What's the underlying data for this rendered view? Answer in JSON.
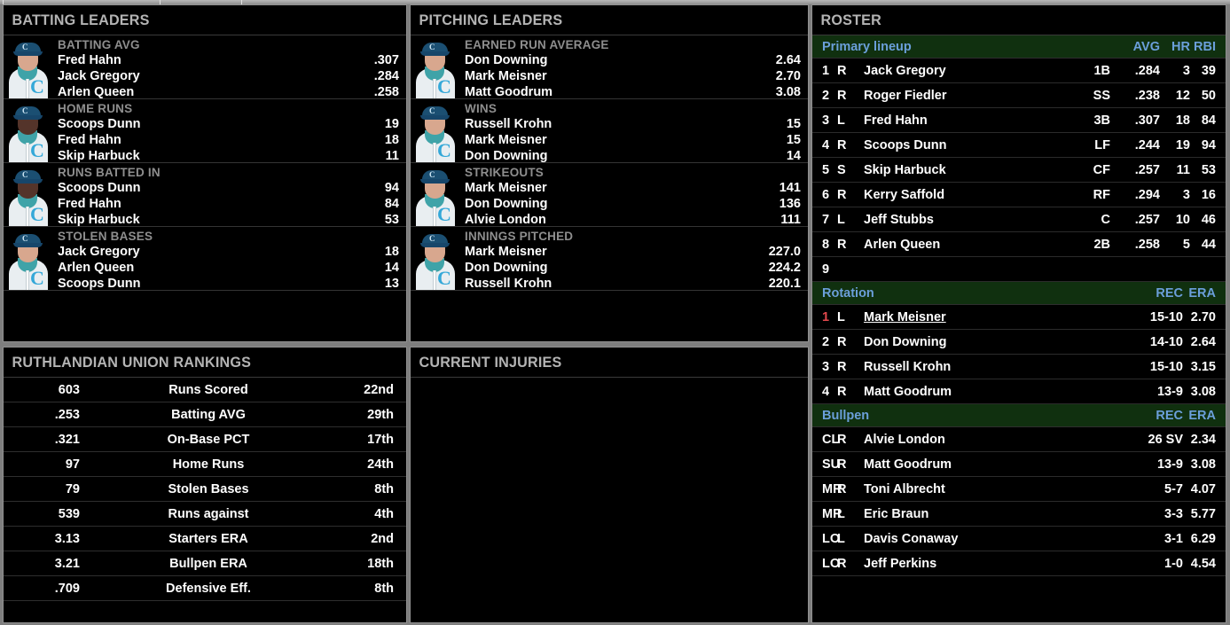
{
  "theme": {
    "panel_bg": "#000000",
    "panel_border": "#909090",
    "app_bg": "#7e7e7e",
    "title_color": "#b4b4b4",
    "section_header_bg": "#10300f",
    "section_header_text": "#6b9fda",
    "highlight_red": "#e2484c"
  },
  "batting_leaders": {
    "title": "BATTING LEADERS",
    "groups": [
      {
        "category": "BATTING AVG",
        "portrait": "player-portrait-light",
        "rows": [
          {
            "name": "Fred Hahn",
            "value": ".307"
          },
          {
            "name": "Jack Gregory",
            "value": ".284"
          },
          {
            "name": "Arlen Queen",
            "value": ".258"
          }
        ]
      },
      {
        "category": "HOME RUNS",
        "portrait": "player-portrait-dark",
        "rows": [
          {
            "name": "Scoops Dunn",
            "value": "19"
          },
          {
            "name": "Fred Hahn",
            "value": "18"
          },
          {
            "name": "Skip Harbuck",
            "value": "11"
          }
        ]
      },
      {
        "category": "RUNS BATTED IN",
        "portrait": "player-portrait-dark",
        "rows": [
          {
            "name": "Scoops Dunn",
            "value": "94"
          },
          {
            "name": "Fred Hahn",
            "value": "84"
          },
          {
            "name": "Skip Harbuck",
            "value": "53"
          }
        ]
      },
      {
        "category": "STOLEN BASES",
        "portrait": "player-portrait-light",
        "rows": [
          {
            "name": "Jack Gregory",
            "value": "18"
          },
          {
            "name": "Arlen Queen",
            "value": "14"
          },
          {
            "name": "Scoops Dunn",
            "value": "13"
          }
        ]
      }
    ]
  },
  "pitching_leaders": {
    "title": "PITCHING LEADERS",
    "groups": [
      {
        "category": "EARNED RUN AVERAGE",
        "portrait": "player-portrait-light",
        "rows": [
          {
            "name": "Don Downing",
            "value": "2.64"
          },
          {
            "name": "Mark Meisner",
            "value": "2.70"
          },
          {
            "name": "Matt Goodrum",
            "value": "3.08"
          }
        ]
      },
      {
        "category": "WINS",
        "portrait": "player-portrait-light",
        "rows": [
          {
            "name": "Russell Krohn",
            "value": "15"
          },
          {
            "name": "Mark Meisner",
            "value": "15"
          },
          {
            "name": "Don Downing",
            "value": "14"
          }
        ]
      },
      {
        "category": "STRIKEOUTS",
        "portrait": "player-portrait-light",
        "rows": [
          {
            "name": "Mark Meisner",
            "value": "141"
          },
          {
            "name": "Don Downing",
            "value": "136"
          },
          {
            "name": "Alvie London",
            "value": "111"
          }
        ]
      },
      {
        "category": "INNINGS PITCHED",
        "portrait": "player-portrait-light",
        "rows": [
          {
            "name": "Mark Meisner",
            "value": "227.0"
          },
          {
            "name": "Don Downing",
            "value": "224.2"
          },
          {
            "name": "Russell Krohn",
            "value": "220.1"
          }
        ]
      }
    ]
  },
  "rankings": {
    "title": "RUTHLANDIAN UNION RANKINGS",
    "rows": [
      {
        "value": "603",
        "label": "Runs Scored",
        "rank": "22nd"
      },
      {
        "value": ".253",
        "label": "Batting AVG",
        "rank": "29th"
      },
      {
        "value": ".321",
        "label": "On-Base PCT",
        "rank": "17th"
      },
      {
        "value": "97",
        "label": "Home Runs",
        "rank": "24th"
      },
      {
        "value": "79",
        "label": "Stolen Bases",
        "rank": "8th"
      },
      {
        "value": "539",
        "label": "Runs against",
        "rank": "4th"
      },
      {
        "value": "3.13",
        "label": "Starters ERA",
        "rank": "2nd"
      },
      {
        "value": "3.21",
        "label": "Bullpen ERA",
        "rank": "18th"
      },
      {
        "value": ".709",
        "label": "Defensive Eff.",
        "rank": "8th"
      }
    ]
  },
  "injuries": {
    "title": "CURRENT INJURIES",
    "rows": []
  },
  "roster": {
    "title": "ROSTER",
    "lineup": {
      "header": {
        "label": "Primary lineup",
        "avg": "AVG",
        "hr": "HR",
        "rbi": "RBI"
      },
      "rows": [
        {
          "slot": "1",
          "hand": "R",
          "name": "Jack Gregory",
          "pos": "1B",
          "avg": ".284",
          "hr": "3",
          "rbi": "39"
        },
        {
          "slot": "2",
          "hand": "R",
          "name": "Roger Fiedler",
          "pos": "SS",
          "avg": ".238",
          "hr": "12",
          "rbi": "50"
        },
        {
          "slot": "3",
          "hand": "L",
          "name": "Fred Hahn",
          "pos": "3B",
          "avg": ".307",
          "hr": "18",
          "rbi": "84"
        },
        {
          "slot": "4",
          "hand": "R",
          "name": "Scoops Dunn",
          "pos": "LF",
          "avg": ".244",
          "hr": "19",
          "rbi": "94"
        },
        {
          "slot": "5",
          "hand": "S",
          "name": "Skip Harbuck",
          "pos": "CF",
          "avg": ".257",
          "hr": "11",
          "rbi": "53"
        },
        {
          "slot": "6",
          "hand": "R",
          "name": "Kerry Saffold",
          "pos": "RF",
          "avg": ".294",
          "hr": "3",
          "rbi": "16"
        },
        {
          "slot": "7",
          "hand": "L",
          "name": "Jeff Stubbs",
          "pos": "C",
          "avg": ".257",
          "hr": "10",
          "rbi": "46"
        },
        {
          "slot": "8",
          "hand": "R",
          "name": "Arlen Queen",
          "pos": "2B",
          "avg": ".258",
          "hr": "5",
          "rbi": "44"
        },
        {
          "slot": "9",
          "hand": "",
          "name": "",
          "pos": "",
          "avg": "",
          "hr": "",
          "rbi": ""
        }
      ]
    },
    "rotation": {
      "header": {
        "label": "Rotation",
        "rec": "REC",
        "era": "ERA"
      },
      "rows": [
        {
          "slot": "1",
          "hand": "L",
          "name": "Mark Meisner",
          "rec": "15-10",
          "era": "2.70",
          "highlight": true,
          "underline": true
        },
        {
          "slot": "2",
          "hand": "R",
          "name": "Don Downing",
          "rec": "14-10",
          "era": "2.64",
          "highlight": false,
          "underline": false
        },
        {
          "slot": "3",
          "hand": "R",
          "name": "Russell Krohn",
          "rec": "15-10",
          "era": "3.15",
          "highlight": false,
          "underline": false
        },
        {
          "slot": "4",
          "hand": "R",
          "name": "Matt Goodrum",
          "rec": "13-9",
          "era": "3.08",
          "highlight": false,
          "underline": false
        }
      ]
    },
    "bullpen": {
      "header": {
        "label": "Bullpen",
        "rec": "REC",
        "era": "ERA"
      },
      "rows": [
        {
          "slot": "CL",
          "hand": "R",
          "name": "Alvie London",
          "rec": "26 SV",
          "era": "2.34"
        },
        {
          "slot": "SU",
          "hand": "R",
          "name": "Matt Goodrum",
          "rec": "13-9",
          "era": "3.08"
        },
        {
          "slot": "MR",
          "hand": "R",
          "name": "Toni Albrecht",
          "rec": "5-7",
          "era": "4.07"
        },
        {
          "slot": "MR",
          "hand": "L",
          "name": "Eric Braun",
          "rec": "3-3",
          "era": "5.77"
        },
        {
          "slot": "LO",
          "hand": "L",
          "name": "Davis Conaway",
          "rec": "3-1",
          "era": "6.29"
        },
        {
          "slot": "LO",
          "hand": "R",
          "name": "Jeff Perkins",
          "rec": "1-0",
          "era": "4.54"
        }
      ]
    }
  }
}
